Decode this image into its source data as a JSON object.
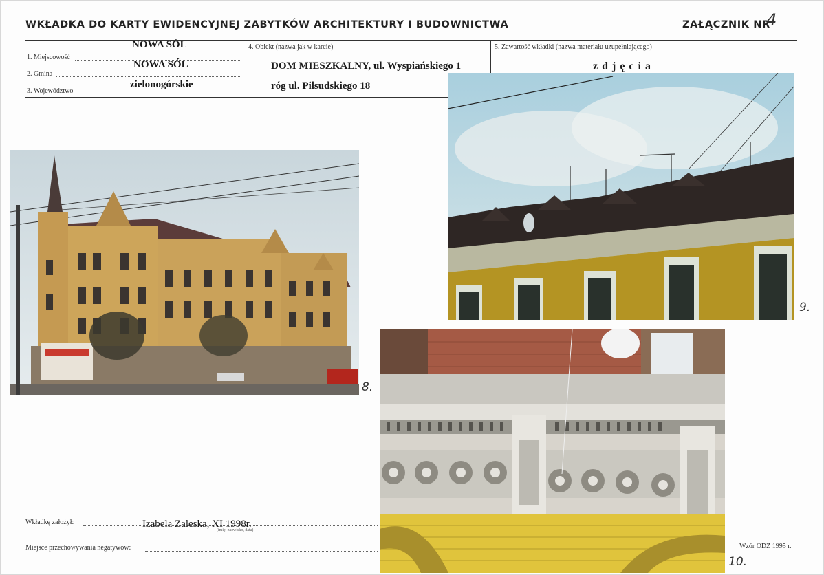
{
  "header": {
    "title": "WKŁADKA DO KARTY EWIDENCYJNEJ ZABYTKÓW ARCHITEKTURY I BUDOWNICTWA",
    "annex_label": "ZAŁĄCZNIK NR",
    "annex_number": "4"
  },
  "fields": {
    "locality_label": "1. Miejscowość",
    "locality_value": "NOWA SÓL",
    "commune_label": "2. Gmina",
    "commune_value": "NOWA SÓL",
    "voivodeship_label": "3. Województwo",
    "voivodeship_value": "zielonogórskie",
    "object_label": "4. Obiekt  (nazwa jak w karcie)",
    "object_line1": "DOM  MIESZKALNY, ul. Wyspiańskiego 1",
    "object_line2": "róg ul. Piłsudskiego 18",
    "content_label": "5. Zawartość wkładki  (nazwa materiału uzupełniającego)",
    "content_value": "z d j ę c i a"
  },
  "photos": {
    "p8_number": "8.",
    "p9_number": "9.",
    "p10_number": "10."
  },
  "footer": {
    "created_label": "Wkładkę założył:",
    "created_value": "Izabela Zaleska, XI 1998r.",
    "created_hint": "(imię, nazwisko, data)",
    "negatives_label": "Miejsce przechowywania negatywów:",
    "model": "Wzór ODZ 1995 r."
  },
  "colors": {
    "sky": "#b9d3e2",
    "facade": "#c8a15a",
    "brick_yellow": "#d9b83a",
    "roof": "#5a3a36",
    "tile": "#a85a45"
  }
}
